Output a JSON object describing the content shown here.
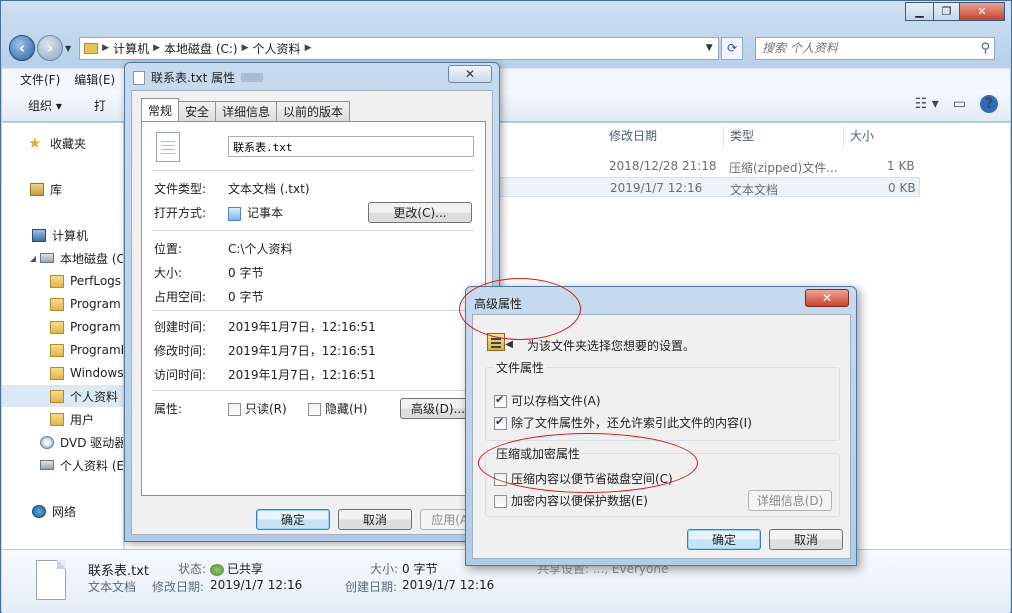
{
  "explorer": {
    "window_controls": {
      "minimize": "▁",
      "maximize": "❐",
      "close": "✕"
    },
    "address": [
      "计算机",
      "本地磁盘 (C:)",
      "个人资料"
    ],
    "search_placeholder": "搜索 个人资料",
    "menu": [
      "文件(F)",
      "编辑(E)"
    ],
    "toolbar": {
      "organize": "组织 ▾",
      "open": "打"
    },
    "nav": {
      "favorites": "收藏夹",
      "libraries": "库",
      "computer": "计算机",
      "local_disk": "本地磁盘 (C",
      "folders": [
        "PerfLogs",
        "Program",
        "Program",
        "ProgramD",
        "Windows",
        "个人资料",
        "用户"
      ],
      "dvd": "DVD 驱动器",
      "personal_e": "个人资料 (E",
      "network": "网络"
    },
    "columns": {
      "modified": "修改日期",
      "type": "类型",
      "size": "大小"
    },
    "files": [
      {
        "modified": "2018/12/28 21:18",
        "type": "压缩(zipped)文件...",
        "size": "1 KB"
      },
      {
        "modified": "2019/1/7 12:16",
        "type": "文本文档",
        "size": "0 KB"
      }
    ],
    "details": {
      "name": "联系表.txt",
      "type": "文本文档",
      "status_label": "状态:",
      "status": "已共享",
      "size_label": "大小:",
      "size": "0 字节",
      "modified_label": "修改日期:",
      "modified": "2019/1/7 12:16",
      "created_label": "创建日期:",
      "created": "2019/1/7 12:16",
      "shared_with_partial": "共享设置: ..., Everyone"
    }
  },
  "props": {
    "title": "联系表.txt 属性",
    "close": "✕",
    "tabs": [
      "常规",
      "安全",
      "详细信息",
      "以前的版本"
    ],
    "filename": "联系表.txt",
    "rows": {
      "filetype_label": "文件类型:",
      "filetype": "文本文档 (.txt)",
      "open_with_label": "打开方式:",
      "open_with": "记事本",
      "change_btn": "更改(C)...",
      "location_label": "位置:",
      "location": "C:\\个人资料",
      "size_label": "大小:",
      "size": "0 字节",
      "size_on_disk_label": "占用空间:",
      "size_on_disk": "0 字节",
      "created_label": "创建时间:",
      "created": "2019年1月7日，12:16:51",
      "modified_label": "修改时间:",
      "modified": "2019年1月7日，12:16:51",
      "accessed_label": "访问时间:",
      "accessed": "2019年1月7日，12:16:51",
      "attributes_label": "属性:",
      "readonly": "只读(R)",
      "hidden": "隐藏(H)",
      "advanced_btn": "高级(D)..."
    },
    "buttons": {
      "ok": "确定",
      "cancel": "取消",
      "apply": "应用(A)"
    }
  },
  "adv": {
    "title": "高级属性",
    "close": "✕",
    "intro": "为该文件夹选择您想要的设置。",
    "file_attrs_label": "文件属性",
    "archive": "可以存档文件(A)",
    "index": "除了文件属性外，还允许索引此文件的内容(I)",
    "compress_group_label": "压缩或加密属性",
    "compress": "压缩内容以便节省磁盘空间(C)",
    "encrypt": "加密内容以便保护数据(E)",
    "details_btn": "详细信息(D)",
    "ok": "确定",
    "cancel": "取消"
  },
  "colors": {
    "annotation": "#d01818",
    "accent": "#2f6db5"
  }
}
